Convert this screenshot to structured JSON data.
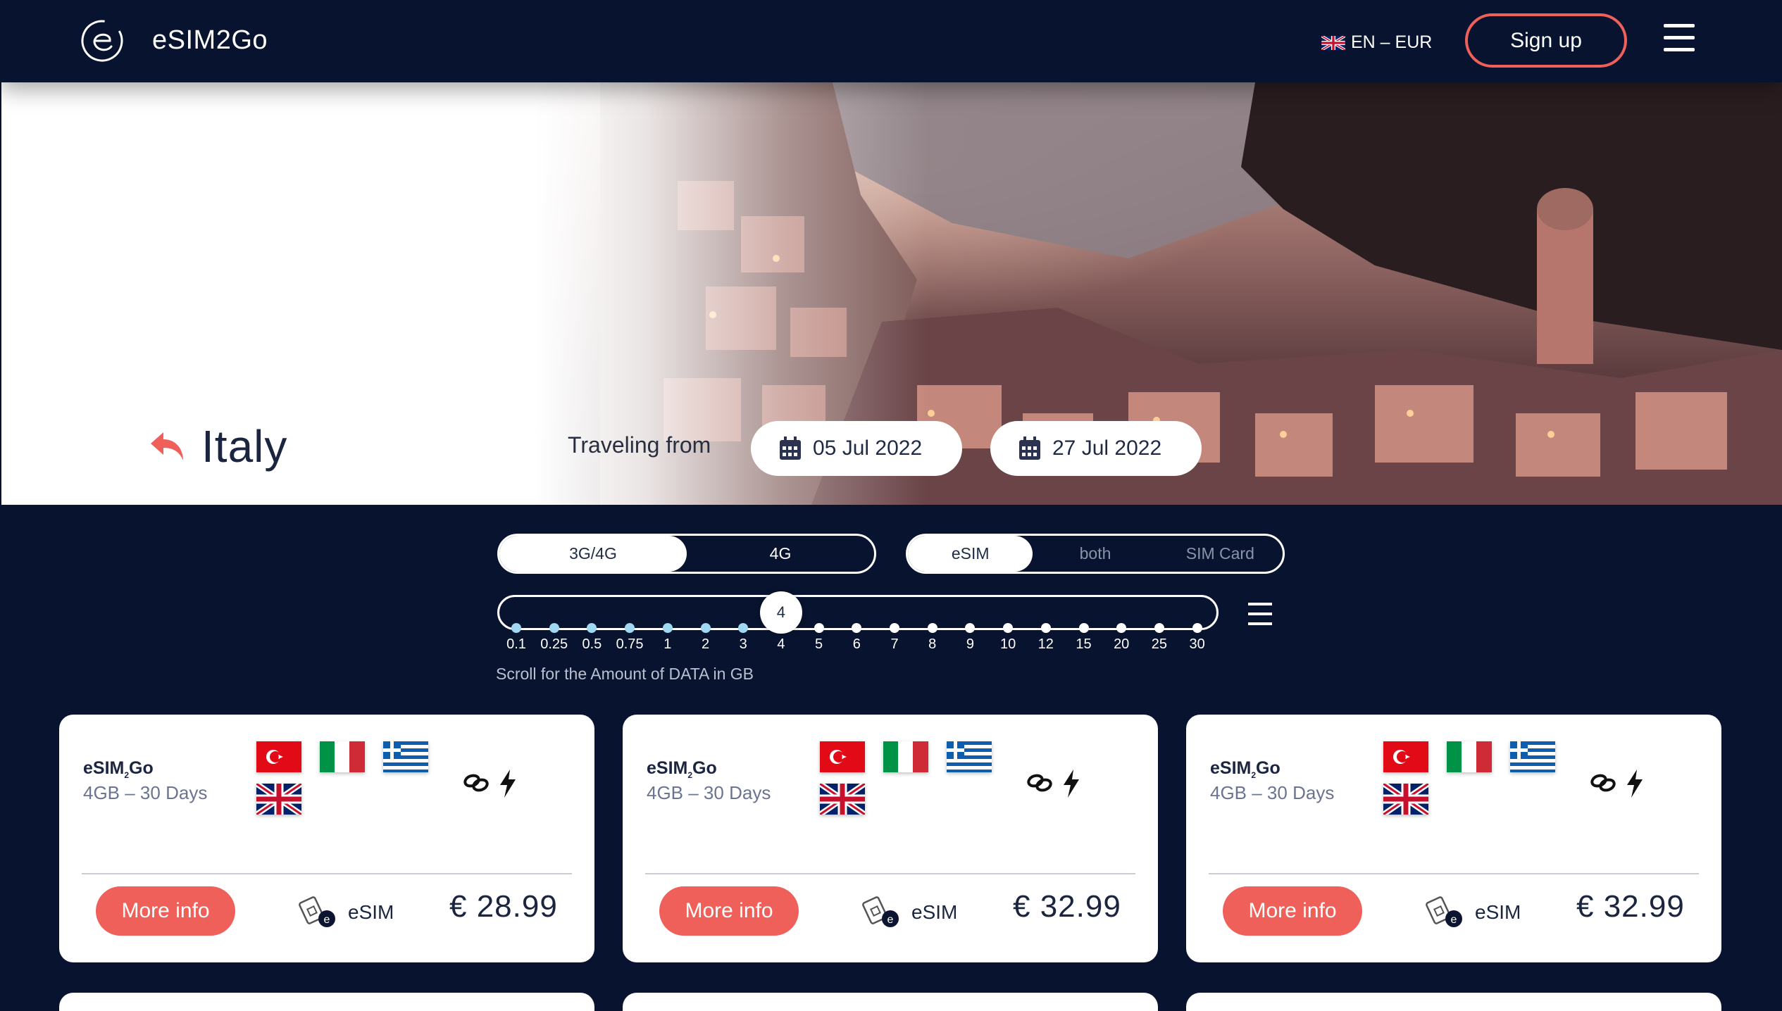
{
  "header": {
    "brand": "eSIM2Go",
    "lang": "EN – EUR",
    "signup": "Sign up"
  },
  "hero": {
    "country": "Italy",
    "traveling_label": "Traveling from",
    "date_from": "05 Jul 2022",
    "date_to": "27 Jul 2022"
  },
  "filters": {
    "network": {
      "options": [
        "3G/4G",
        "4G"
      ],
      "selected": "3G/4G"
    },
    "sim_type": {
      "options": [
        "eSIM",
        "both",
        "SIM Card"
      ],
      "selected": "eSIM"
    },
    "data_amounts": [
      "0.1",
      "0.25",
      "0.5",
      "0.75",
      "1",
      "2",
      "3",
      "4",
      "5",
      "6",
      "7",
      "8",
      "9",
      "10",
      "12",
      "15",
      "20",
      "25",
      "30"
    ],
    "selected_amount": "4",
    "scroll_hint": "Scroll for the Amount of DATA in GB"
  },
  "cards": [
    {
      "provider_a": "eSIM",
      "provider_sub": "2",
      "provider_b": "Go",
      "plan": "4GB – 30 Days",
      "more": "More info",
      "sim": "eSIM",
      "price": "€ 28.99"
    },
    {
      "provider_a": "eSIM",
      "provider_sub": "2",
      "provider_b": "Go",
      "plan": "4GB – 30 Days",
      "more": "More info",
      "sim": "eSIM",
      "price": "€ 32.99"
    },
    {
      "provider_a": "eSIM",
      "provider_sub": "2",
      "provider_b": "Go",
      "plan": "4GB – 30 Days",
      "more": "More info",
      "sim": "eSIM",
      "price": "€ 32.99"
    }
  ],
  "colors": {
    "navy": "#08142f",
    "accent": "#f0605a",
    "white": "#ffffff"
  },
  "icons": [
    "logo-icon",
    "uk-flag-icon",
    "menu-icon",
    "back-arrow-icon",
    "calendar-icon",
    "list-icon",
    "turkey-flag-icon",
    "italy-flag-icon",
    "greece-flag-icon",
    "uk-flag-icon",
    "link-icon",
    "bolt-icon",
    "sim-card-icon"
  ]
}
